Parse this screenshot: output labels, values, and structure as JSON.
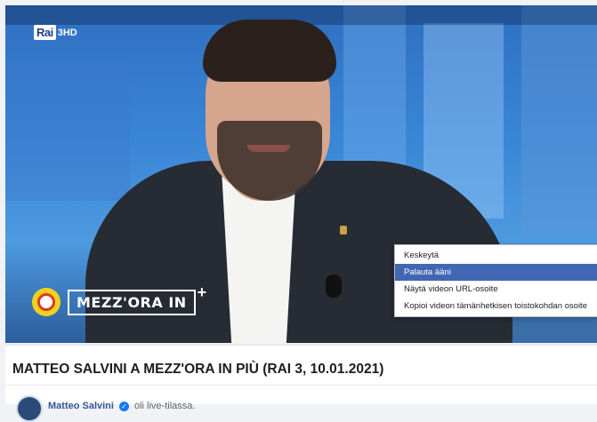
{
  "video": {
    "channel_logo": "Rai",
    "channel_number": "3HD",
    "show_logo": "MEZZ'ORA IN",
    "show_logo_plus": "+"
  },
  "context_menu": {
    "items": [
      {
        "label": "Keskeytä",
        "highlighted": false
      },
      {
        "label": "Palauta ääni",
        "highlighted": true
      },
      {
        "label": "Näytä videon URL-osoite",
        "highlighted": false
      },
      {
        "label": "Kopioi videon tämänhetkisen toistokohdan osoite",
        "highlighted": false
      }
    ],
    "highlight_color": "#4267b2"
  },
  "post": {
    "title": "MATTEO SALVINI A MEZZ'ORA IN PIÙ (RAI 3, 10.01.2021)",
    "author_name": "Matteo Salvini",
    "verified_icon": "verified-badge-icon",
    "author_status": "oli live-tilassa."
  },
  "colors": {
    "link": "#385898",
    "background": "#f0f2f5"
  }
}
